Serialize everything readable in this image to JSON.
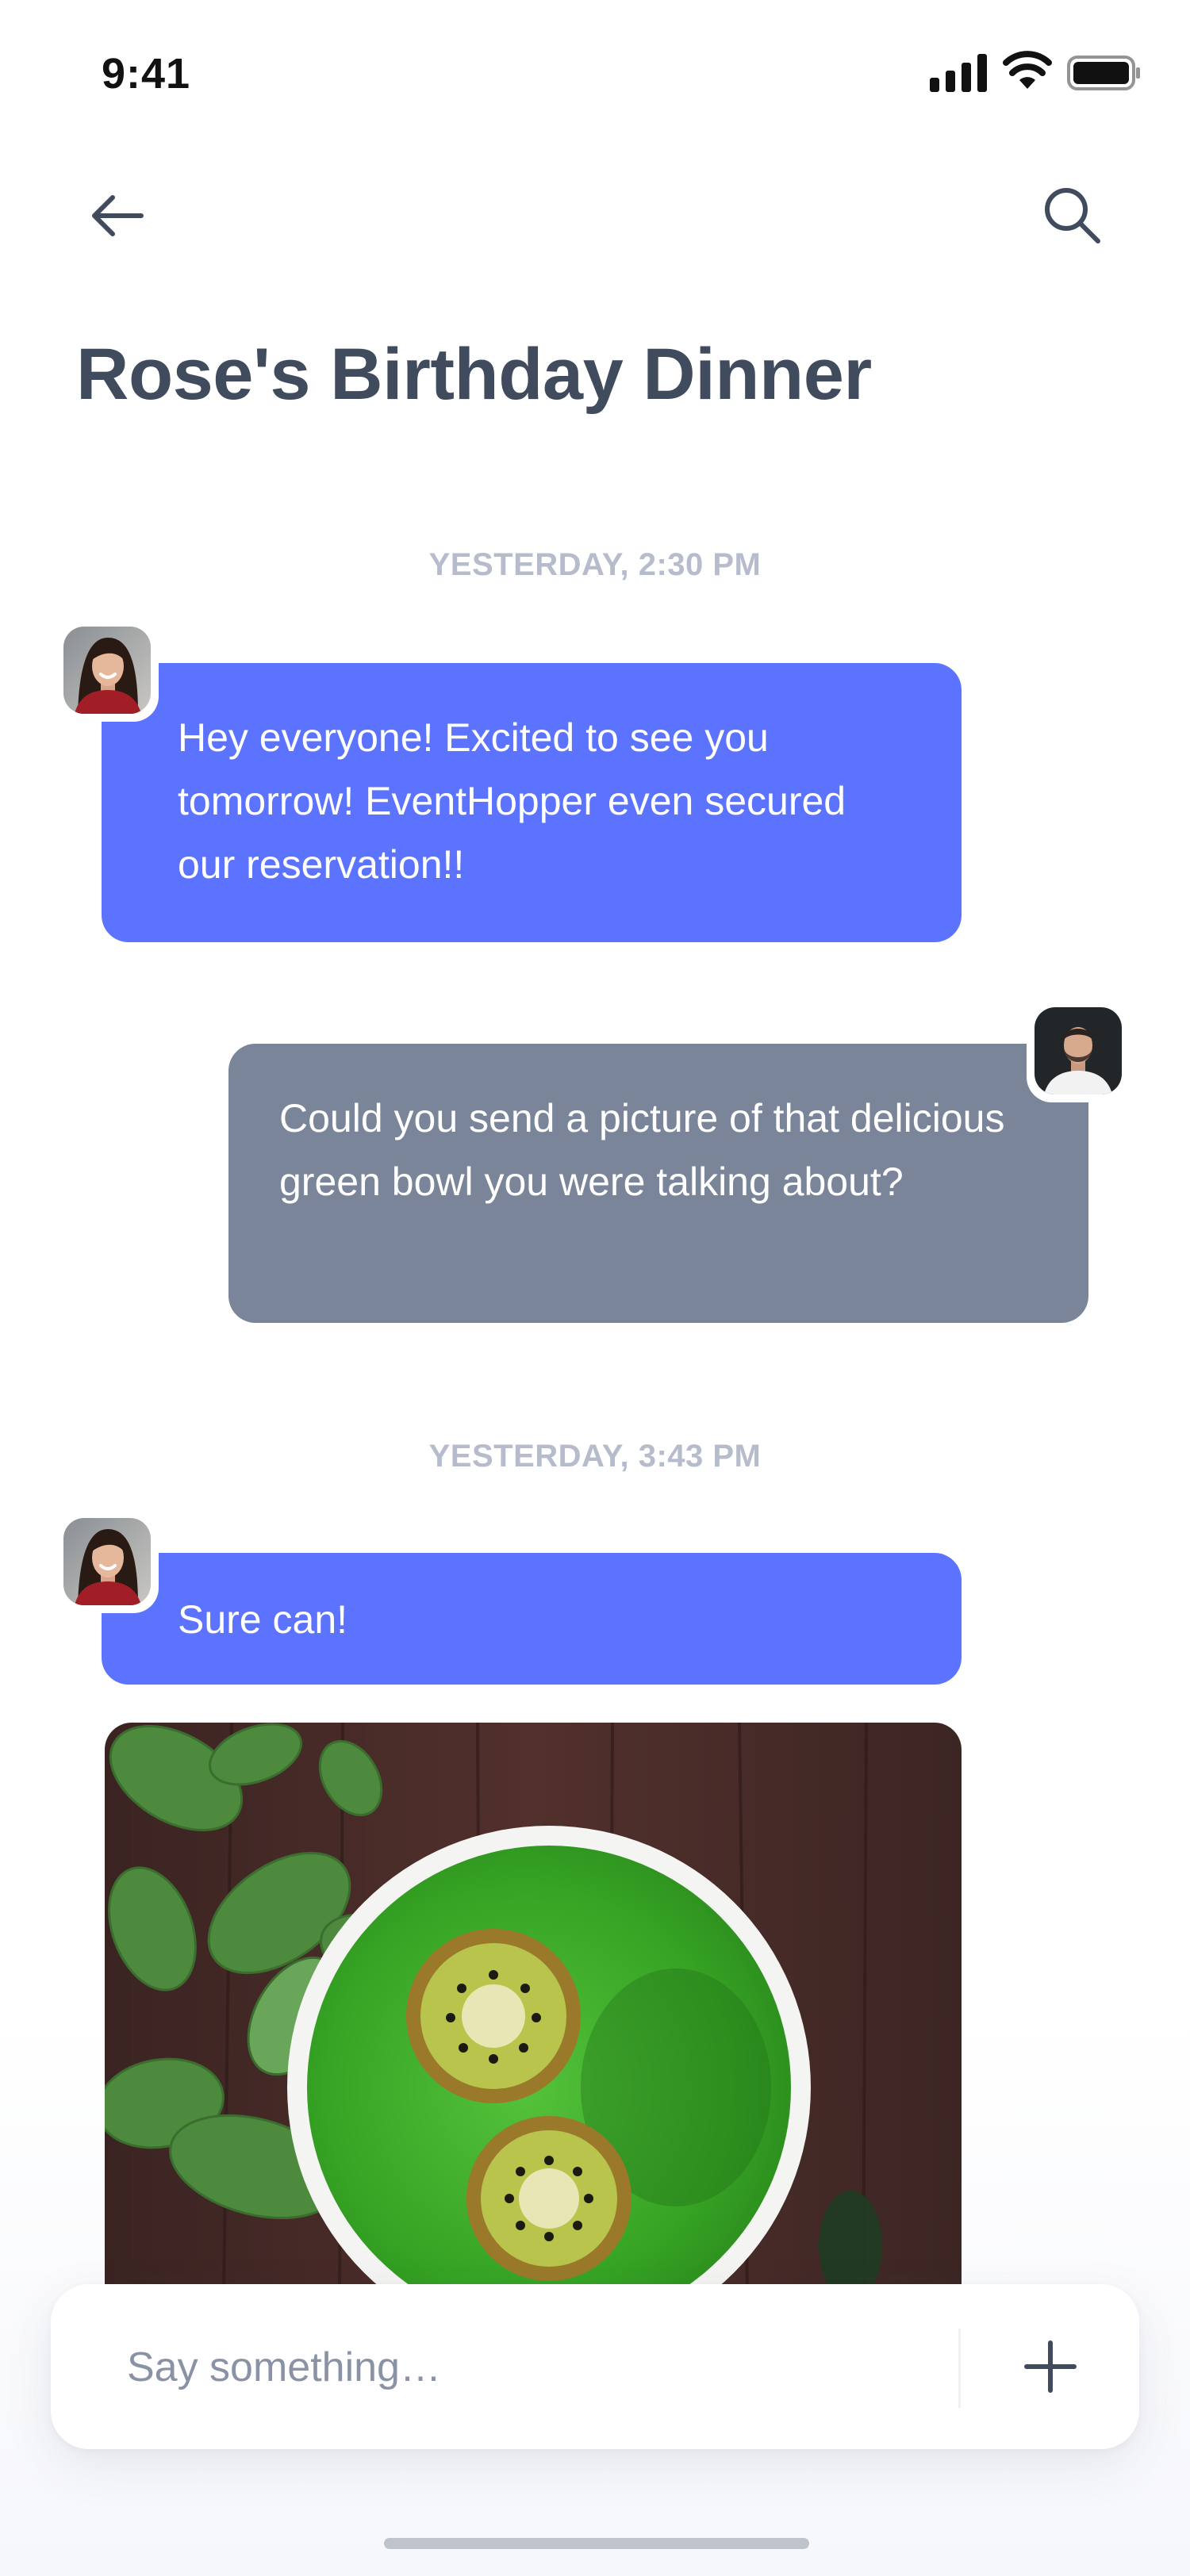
{
  "status_bar": {
    "time": "9:41"
  },
  "header": {
    "title": "Rose's Birthday Dinner"
  },
  "messages": [
    {
      "timestamp": "YESTERDAY, 2:30 PM"
    },
    {
      "sender": "Rose",
      "type": "text",
      "text": "Hey everyone! Excited to see you tomorrow! EventHopper even secured our reservation!!"
    },
    {
      "sender": "me",
      "type": "text",
      "text": "Could you send a picture of that delicious green bowl you were talking about?"
    },
    {
      "timestamp": "YESTERDAY, 3:43 PM"
    },
    {
      "sender": "Rose",
      "type": "text",
      "text": "Sure can!"
    },
    {
      "sender": "Rose",
      "type": "image",
      "image": "green-smoothie-bowl-with-kiwi-and-spinach"
    }
  ],
  "composer": {
    "placeholder": "Say something…"
  },
  "icons": {
    "back": "arrow-left-icon",
    "search": "search-icon",
    "add": "plus-icon",
    "signal": "cellular-signal-icon",
    "wifi": "wifi-icon",
    "battery": "battery-icon"
  },
  "colors": {
    "incoming_bubble": "#5b73fe",
    "outgoing_bubble": "#7a8599",
    "title": "#414b5e",
    "timestamp": "#b6bccb"
  }
}
